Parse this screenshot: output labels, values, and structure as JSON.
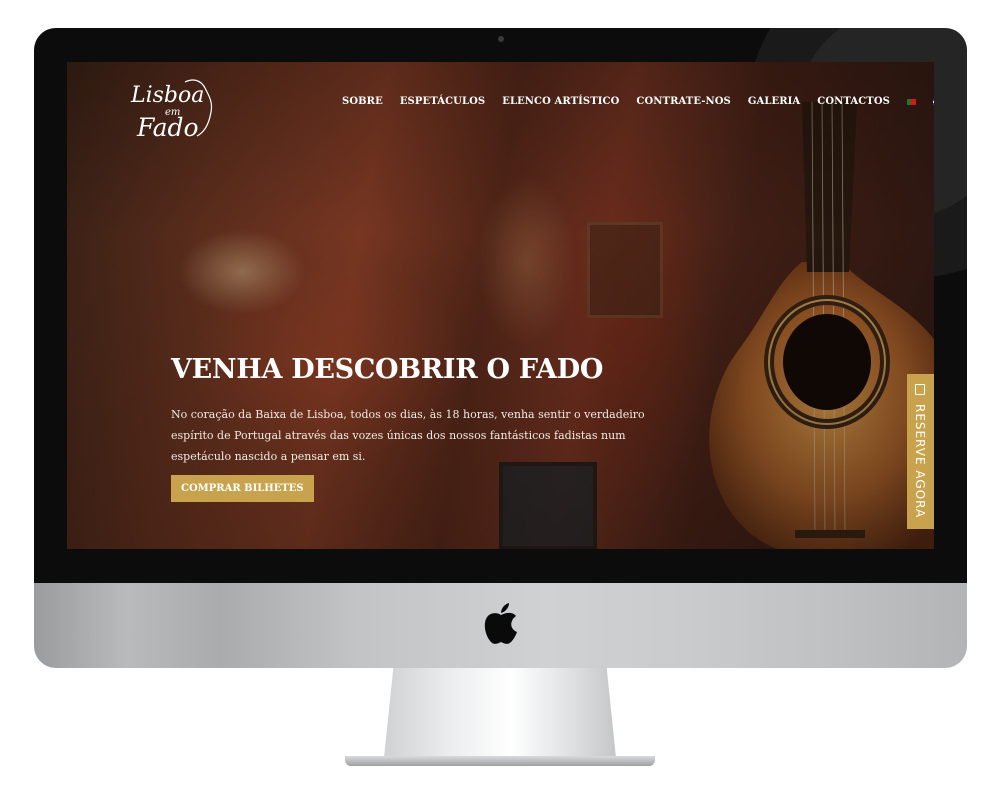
{
  "site": {
    "logo": {
      "line1": "Lisboa",
      "line2": "em",
      "line3": "Fado"
    },
    "nav": {
      "items": [
        {
          "label": "SOBRE"
        },
        {
          "label": "ESPETÁCULOS"
        },
        {
          "label": "ELENCO ARTÍSTICO"
        },
        {
          "label": "CONTRATE-NOS"
        },
        {
          "label": "GALERIA"
        },
        {
          "label": "CONTACTOS"
        }
      ],
      "languages": [
        {
          "icon": "portugal-flag-icon"
        },
        {
          "icon": "uk-flag-icon"
        }
      ]
    },
    "hero": {
      "title": "VENHA DESCOBRIR O FADO",
      "text": "No coração da Baixa de Lisboa, todos os dias, às 18 horas, venha sentir o verdadeiro espírito de Portugal através das vozes únicas dos nossos fantásticos fadistas num espetáculo nascido a pensar em si.",
      "cta_label": "COMPRAR BILHETES"
    },
    "reserve_tab": {
      "label": "RESERVE AGORA",
      "icon": "calendar-icon"
    },
    "colors": {
      "accent": "#c9a24d",
      "text": "#ffffff"
    }
  },
  "device": {
    "logo_icon": "apple-logo-icon"
  }
}
